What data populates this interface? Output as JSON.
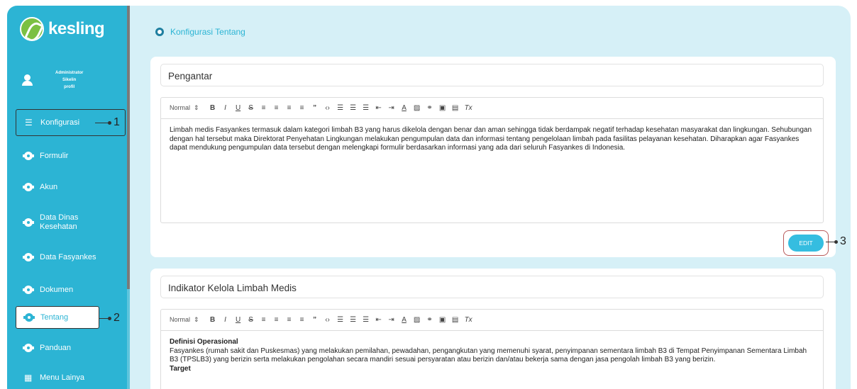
{
  "brand": {
    "name": "kesling"
  },
  "user": {
    "line1": "Administrator",
    "line2": "Sikelin",
    "line3": "profil"
  },
  "sidebar": {
    "items": [
      {
        "label": "Konfigurasi",
        "icon": "sliders-icon"
      },
      {
        "label": "Formulir",
        "icon": "gear-icon"
      },
      {
        "label": "Akun",
        "icon": "gear-icon"
      },
      {
        "label": "Data Dinas Kesehatan",
        "icon": "gear-icon"
      },
      {
        "label": "Data Fasyankes",
        "icon": "gear-icon"
      },
      {
        "label": "Dokumen",
        "icon": "gear-icon"
      },
      {
        "label": "Tentang",
        "icon": "gear-icon"
      },
      {
        "label": "Panduan",
        "icon": "gear-icon"
      },
      {
        "label": "Menu Lainya",
        "icon": "grid-icon"
      }
    ]
  },
  "callouts": {
    "c1": "1",
    "c2": "2",
    "c3": "3"
  },
  "page": {
    "title": "Konfigurasi Tentang"
  },
  "toolbar": {
    "format": "Normal",
    "format_arrow": "↕"
  },
  "card1": {
    "title": "Pengantar",
    "body": "Limbah medis Fasyankes termasuk dalam kategori limbah B3 yang harus dikelola dengan benar dan aman sehingga tidak berdampak negatif terhadap kesehatan masyarakat dan lingkungan. Sehubungan dengan hal tersebut maka Direktorat Penyehatan Lingkungan melakukan pengumpulan data dan informasi tentang pengelolaan limbah pada fasilitas pelayanan kesehatan. Diharapkan agar Fasyankes dapat mendukung pengumpulan data tersebut dengan melengkapi formulir berdasarkan informasi yang ada dari seluruh Fasyankes di Indonesia.",
    "edit_label": "EDIT"
  },
  "card2": {
    "title": "Indikator Kelola Limbah Medis",
    "heading1": "Definisi Operasional",
    "body": "Fasyankes (rumah sakit dan Puskesmas) yang melakukan pemilahan, pewadahan, pengangkutan yang memenuhi syarat, penyimpanan sementara limbah B3 di Tempat Penyimpanan Sementara Limbah B3 (TPSLB3) yang berizin serta melakukan pengolahan secara mandiri sesuai persyaratan atau berizin dan/atau bekerja sama dengan jasa pengolah limbah B3 yang berizin.",
    "heading2": "Target"
  },
  "colors": {
    "accent": "#2cb4d4",
    "background": "#d6f0f7",
    "button": "#35bde0"
  }
}
